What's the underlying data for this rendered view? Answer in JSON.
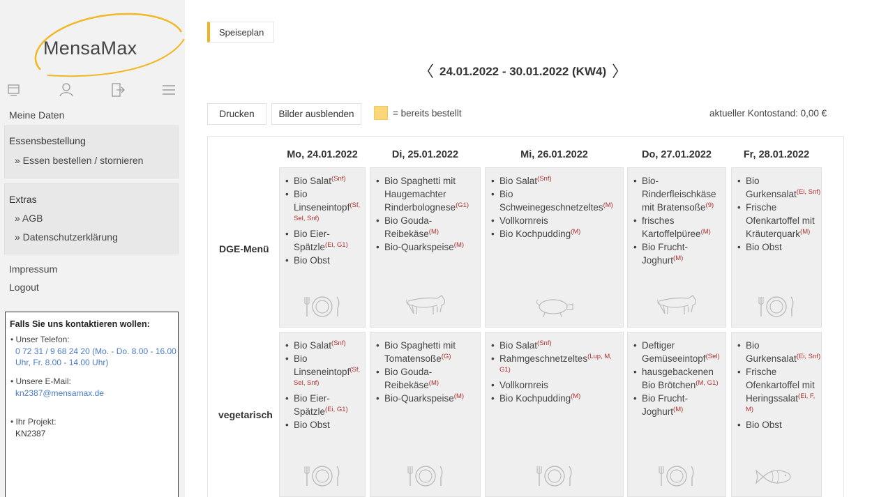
{
  "sidebar": {
    "logo_text": "MensaMax",
    "icons": [
      "cart-icon",
      "user-icon",
      "logout-icon",
      "menu-icon"
    ],
    "my_data": "Meine Daten",
    "orders": {
      "title": "Essensbestellung",
      "items": [
        "» Essen bestellen / stornieren"
      ]
    },
    "extras": {
      "title": "Extras",
      "items": [
        "» AGB",
        "» Datenschutzerklärung"
      ]
    },
    "impressum": "Impressum",
    "logout": "Logout",
    "contact": {
      "title": "Falls Sie uns kontaktieren wollen:",
      "phone_label": "• Unser Telefon:",
      "phone_value": "0 72 31 / 9 68 24 20 (Mo. - Do. 8.00 - 16.00 Uhr, Fr. 8.00 - 14.00 Uhr)",
      "email_label": "• Unsere E-Mail:",
      "email_value": "kn2387@mensamax.de",
      "project_label": "• Ihr Projekt:",
      "project_value": "KN2387"
    }
  },
  "main": {
    "tab": "Speiseplan",
    "week": "24.01.2022 - 30.01.2022 (KW4)",
    "buttons": {
      "print": "Drucken",
      "hide_images": "Bilder ausblenden"
    },
    "legend": "= bereits bestellt",
    "balance": "aktueller Kontostand: 0,00 €",
    "colors": {
      "accent": "#f0b422",
      "ordered": "#fbd77c",
      "allergen": "#b03030",
      "link": "#4a7bc8"
    }
  },
  "plan": {
    "days": [
      "Mo, 24.01.2022",
      "Di, 25.01.2022",
      "Mi, 26.01.2022",
      "Do, 27.01.2022",
      "Fr, 28.01.2022"
    ],
    "rows": [
      {
        "label": "DGE-Menü",
        "cells": [
          {
            "items": [
              [
                "Bio Salat",
                "(Snf)"
              ],
              [
                "Bio Linseneintopf",
                "(Sf, Sel, Snf)"
              ],
              [
                "Bio Eier-Spätzle",
                "(Ei, G1)"
              ],
              [
                "Bio Obst",
                ""
              ]
            ],
            "icon": "plate-icon"
          },
          {
            "items": [
              [
                "Bio Spaghetti mit Haugemachter Rinderbolognese",
                "(G1)"
              ],
              [
                "Bio Gouda-Reibekäse",
                "(M)"
              ],
              [
                "Bio-Quarkspeise",
                "(M)"
              ]
            ],
            "icon": "cow-icon"
          },
          {
            "items": [
              [
                "Bio Salat",
                "(Snf)"
              ],
              [
                "Bio Schweinegeschnetzeltes",
                "(M)"
              ],
              [
                "Vollkornreis",
                ""
              ],
              [
                "Bio Kochpudding",
                "(M)"
              ]
            ],
            "icon": "pig-icon"
          },
          {
            "items": [
              [
                "Bio-Rinderfleischkäse mit Bratensoße",
                "(9)"
              ],
              [
                "frisches Kartoffelpüree",
                "(M)"
              ],
              [
                "Bio Frucht-Joghurt",
                "(M)"
              ]
            ],
            "icon": "cow-icon"
          },
          {
            "items": [
              [
                "Bio Gurkensalat",
                "(Ei, Snf)"
              ],
              [
                "Frische Ofenkartoffel mit Kräuterquark",
                "(M)"
              ],
              [
                "Bio Obst",
                ""
              ]
            ],
            "icon": "plate-icon"
          }
        ]
      },
      {
        "label": "vegetarisch",
        "cells": [
          {
            "items": [
              [
                "Bio Salat",
                "(Snf)"
              ],
              [
                "Bio Linseneintopf",
                "(Sf, Sel, Snf)"
              ],
              [
                "Bio Eier-Spätzle",
                "(Ei, G1)"
              ],
              [
                "Bio Obst",
                ""
              ]
            ],
            "icon": "plate-icon"
          },
          {
            "items": [
              [
                "Bio Spaghetti mit Tomatensoße",
                "(G)"
              ],
              [
                "Bio Gouda-Reibekäse",
                "(M)"
              ],
              [
                "Bio-Quarkspeise",
                "(M)"
              ]
            ],
            "icon": "plate-icon"
          },
          {
            "items": [
              [
                "Bio Salat",
                "(Snf)"
              ],
              [
                "Rahmgeschnetzeltes",
                "(Lup, M, G1)"
              ],
              [
                "Vollkornreis",
                ""
              ],
              [
                "Bio Kochpudding",
                "(M)"
              ]
            ],
            "icon": "plate-icon"
          },
          {
            "items": [
              [
                "Deftiger Gemüseeintopf",
                "(Sel)"
              ],
              [
                "hausgebackenen Bio Brötchen",
                "(M, G1)"
              ],
              [
                "Bio Frucht-Joghurt",
                "(M)"
              ]
            ],
            "icon": "plate-icon"
          },
          {
            "items": [
              [
                "Bio Gurkensalat",
                "(Ei, Snf)"
              ],
              [
                "Frische Ofenkartoffel mit Heringssalat",
                "(Ei, F, M)"
              ],
              [
                "Bio Obst",
                ""
              ]
            ],
            "icon": "fish-icon"
          }
        ]
      }
    ]
  }
}
